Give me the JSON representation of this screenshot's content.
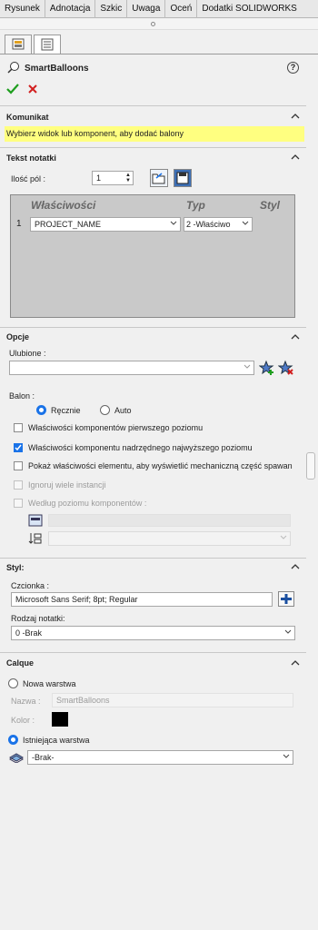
{
  "command_tabs": [
    "Rysunek",
    "Adnotacja",
    "Szkic",
    "Uwaga",
    "Oceń",
    "Dodatki SOLIDWORKS"
  ],
  "panel": {
    "title": "SmartBalloons",
    "help": "?"
  },
  "message": {
    "header": "Komunikat",
    "text": "Wybierz widok lub komponent, aby dodać balony"
  },
  "note_text": {
    "header": "Tekst notatki",
    "field_count_label": "Ilość pól :",
    "field_count_value": "1",
    "table_headers": {
      "properties": "Właściwości",
      "type": "Typ",
      "style": "Styl"
    },
    "rows": [
      {
        "index": "1",
        "property": "PROJECT_NAME",
        "type": "2 -Właściwo"
      }
    ]
  },
  "options": {
    "header": "Opcje",
    "favorites_label": "Ulubione :",
    "favorites_value": "",
    "balloon_label": "Balon :",
    "radio_manual": "Ręcznie",
    "radio_auto": "Auto",
    "chk1": "Właściwości komponentów pierwszego poziomu",
    "chk2": "Właściwości komponentu nadrzędnego najwyższego poziomu",
    "chk3": "Pokaż właściwości elementu, aby wyświetlić mechaniczną część spawan",
    "chk4": "Ignoruj wiele instancji",
    "chk5": "Według poziomu komponentów :"
  },
  "style": {
    "header": "Styl:",
    "font_label": "Czcionka :",
    "font_value": "Microsoft Sans Serif; 8pt; Regular",
    "note_type_label": "Rodzaj notatki:",
    "note_type_value": "0 -Brak"
  },
  "layer": {
    "header": "Calque",
    "new_layer": "Nowa warstwa",
    "name_label": "Nazwa :",
    "name_value": "SmartBalloons",
    "color_label": "Kolor :",
    "existing_layer": "Istniejąca warstwa",
    "existing_value": "-Brak-"
  },
  "colors": {
    "accent": "#1a73e8",
    "message_bg": "#ffff80",
    "ok_green": "#1e9e1e",
    "cancel_red": "#d21f1f"
  }
}
